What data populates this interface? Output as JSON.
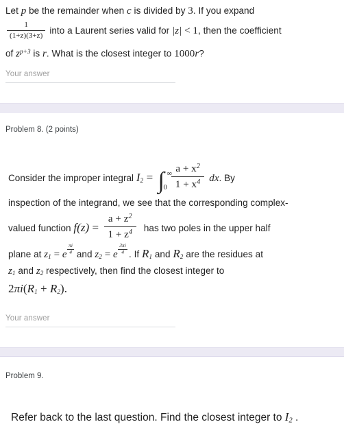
{
  "problem7_tail": {
    "line1_a": "Let ",
    "line1_p": "p",
    "line1_b": " be the remainder when ",
    "line1_c": "c",
    "line1_d": " is divided by ",
    "line1_three": "3",
    "line1_e": ". If you expand",
    "frac_num": "1",
    "frac_den": "(1+z)(3+z)",
    "line2_a": "into a Laurent series valid for ",
    "line2_mod": "|z|",
    "line2_lt": " < ",
    "line2_one": "1",
    "line2_b": ", then the coefficient",
    "line3_a": "of ",
    "line3_z": "z",
    "line3_exp": "p+3",
    "line3_b": " is ",
    "line3_r": "r",
    "line3_c": ". What is the closest integer to ",
    "line3_1000": "1000",
    "line3_r2": "r",
    "line3_q": "?",
    "answer_placeholder": "Your answer"
  },
  "section8": {
    "title": "Problem 8. (2 points)",
    "p1_a": "Consider the improper integral ",
    "p1_I": "I",
    "p1_I_sub": "2",
    "p1_eq": " = ",
    "int_upper": "∞",
    "int_lower": "0",
    "int_sign": "∫",
    "int_num": "a + x",
    "int_num_exp": "2",
    "int_den": "1 + x",
    "int_den_exp": "4",
    "p1_dx": "dx",
    "p1_by": ". By",
    "p2": "inspection of the integrand, we see that the corresponding complex-",
    "p3_a": "valued function ",
    "p3_f": "f",
    "p3_fz": "(z)",
    "p3_eq": " = ",
    "f_num": "a + z",
    "f_num_exp": "2",
    "f_den": "1 + z",
    "f_den_exp": "4",
    "p3_b": " has two poles in the upper half",
    "p4_a": "plane at ",
    "p4_z1": "z",
    "p4_z1_sub": "1",
    "p4_eq1": " = ",
    "p4_e1": "e",
    "p4_e1_num": "πi",
    "p4_e1_den": "4",
    "p4_and": " and ",
    "p4_z2": "z",
    "p4_z2_sub": "2",
    "p4_eq2": " = ",
    "p4_e2": "e",
    "p4_e2_num": "3πi",
    "p4_e2_den": "4",
    "p4_b": ". If ",
    "p4_R1": "R",
    "p4_R1_sub": "1",
    "p4_and2": " and ",
    "p4_R2": "R",
    "p4_R2_sub": "2",
    "p4_c": " are the residues at",
    "p5_z1": "z",
    "p5_z1_sub": "1",
    "p5_and": " and ",
    "p5_z2": "z",
    "p5_z2_sub": "2",
    "p5_rest": " respectively, then find the closest integer to",
    "p6_2": "2",
    "p6_pi": "πi",
    "p6_open": "(",
    "p6_R1": "R",
    "p6_R1_sub": "1",
    "p6_plus": " + ",
    "p6_R2": "R",
    "p6_R2_sub": "2",
    "p6_close": ").",
    "answer_placeholder": "Your answer"
  },
  "section9": {
    "title": "Problem 9.",
    "prompt_a": "Refer back to the last question. Find the closest integer to ",
    "prompt_I": "I",
    "prompt_I_sub": "2",
    "prompt_b": " ."
  },
  "colors": {
    "band": "#eceaf4",
    "rule": "#dadce0",
    "placeholder": "#9e9e9e",
    "text": "#222222"
  }
}
